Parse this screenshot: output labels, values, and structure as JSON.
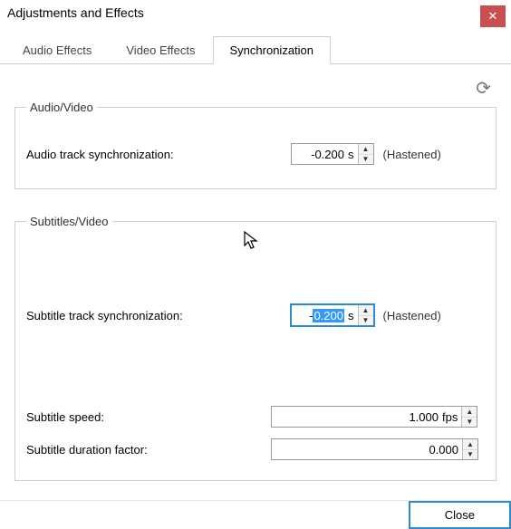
{
  "window": {
    "title": "Adjustments and Effects",
    "close_glyph": "✕"
  },
  "tabs": {
    "audio_effects": "Audio Effects",
    "video_effects": "Video Effects",
    "synchronization": "Synchronization"
  },
  "refresh_icon": "⟳",
  "groups": {
    "av": {
      "legend": "Audio/Video",
      "audio_sync_label": "Audio track synchronization:",
      "audio_sync_value": "-0.200",
      "audio_sync_unit": "s",
      "audio_sync_status": "(Hastened)"
    },
    "sv": {
      "legend": "Subtitles/Video",
      "sub_sync_label": "Subtitle track synchronization:",
      "sub_sync_value_pre": "-",
      "sub_sync_value_sel": "0.200",
      "sub_sync_unit": "s",
      "sub_sync_status": "(Hastened)",
      "sub_speed_label": "Subtitle speed:",
      "sub_speed_value": "1.000",
      "sub_speed_unit": "fps",
      "sub_duration_label": "Subtitle duration factor:",
      "sub_duration_value": "0.000"
    }
  },
  "buttons": {
    "close": "Close"
  },
  "spin": {
    "up": "▲",
    "down": "▼"
  },
  "cursor_glyph": "↖"
}
